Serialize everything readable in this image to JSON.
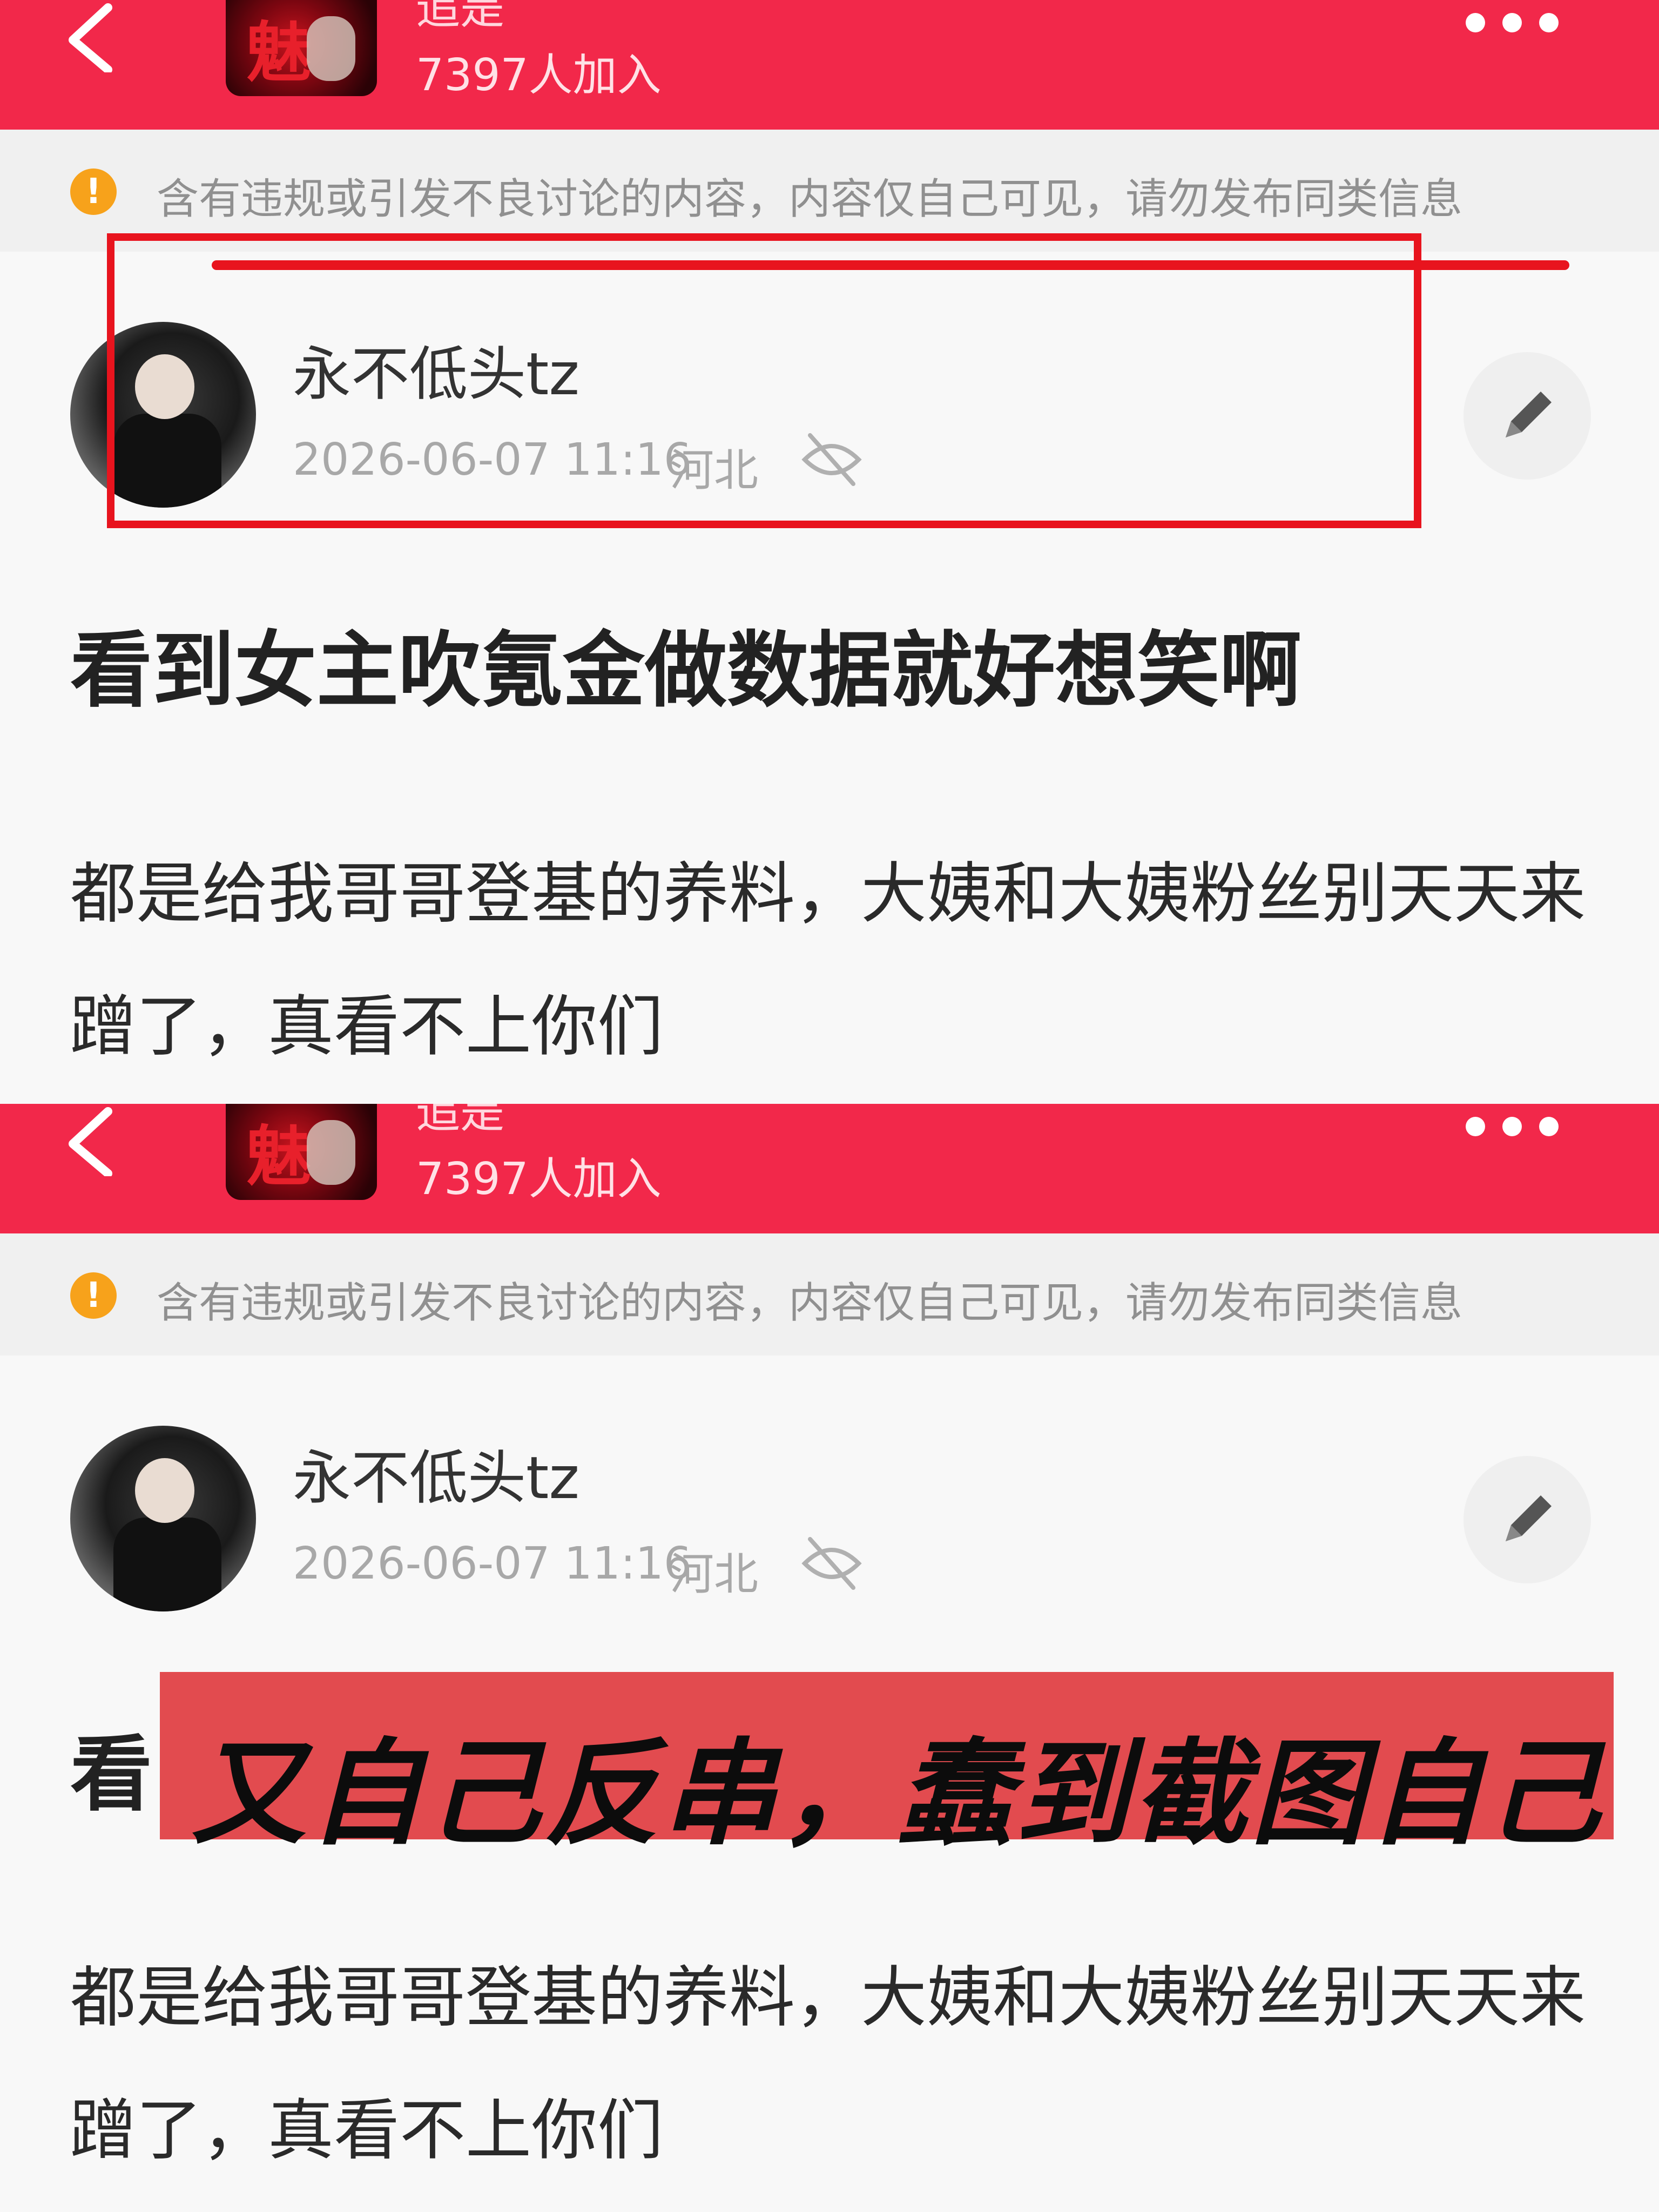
{
  "header": {
    "group_name": "追是",
    "member_count": "7397人加入"
  },
  "notice": {
    "text": "含有违规或引发不良讨论的内容，内容仅自己可见，请勿发布同类信息"
  },
  "post": {
    "username": "永不低头tz",
    "datetime": "2026-06-07 11:16",
    "region": "河北",
    "title": "看到女主吹氪金做数据就好想笑啊",
    "body": "都是给我哥哥登基的养料，大姨和大姨粉丝别天天来蹭了，真看不上你们",
    "title_visible_prefix": "看"
  },
  "annotation": {
    "caption": "又自己反串，蠢到截图自己",
    "highlight_color": "#e8141e",
    "caption_bg": "#e24b4f"
  },
  "colors": {
    "header_bg": "#f2284a",
    "warning": "#f7a21b"
  },
  "icons": [
    "back-icon",
    "more-icon",
    "warning-icon",
    "hidden-eye-icon",
    "edit-pencil-icon"
  ]
}
